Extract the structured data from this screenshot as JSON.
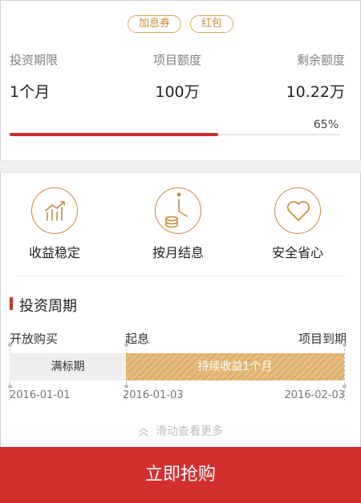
{
  "tags": [
    "加息券",
    "红包"
  ],
  "stats": [
    {
      "label": "投资期限",
      "value": "1个月"
    },
    {
      "label": "项目额度",
      "value": "100万"
    },
    {
      "label": "剩余额度",
      "value": "10.22万"
    }
  ],
  "progress": {
    "percent_text": "65%",
    "fraction": 0.65
  },
  "features": [
    {
      "icon": "chart-growth-icon",
      "label": "收益稳定"
    },
    {
      "icon": "clock-coins-icon",
      "label": "按月结息"
    },
    {
      "icon": "heart-icon",
      "label": "安全省心"
    }
  ],
  "section_title": "投资周期",
  "timeline": {
    "labels": [
      "开放购买",
      "起息",
      "项目到期"
    ],
    "segments": [
      "满标期",
      "持续收益1个月"
    ],
    "dates": [
      "2016-01-01",
      "2016-01-03",
      "2016-02-03"
    ]
  },
  "more_text": "滑动查看更多",
  "buy_label": "立即抢购",
  "colors": {
    "accent": "#d32f2f",
    "gold": "#c98a38",
    "stripe": "#deb06c"
  }
}
